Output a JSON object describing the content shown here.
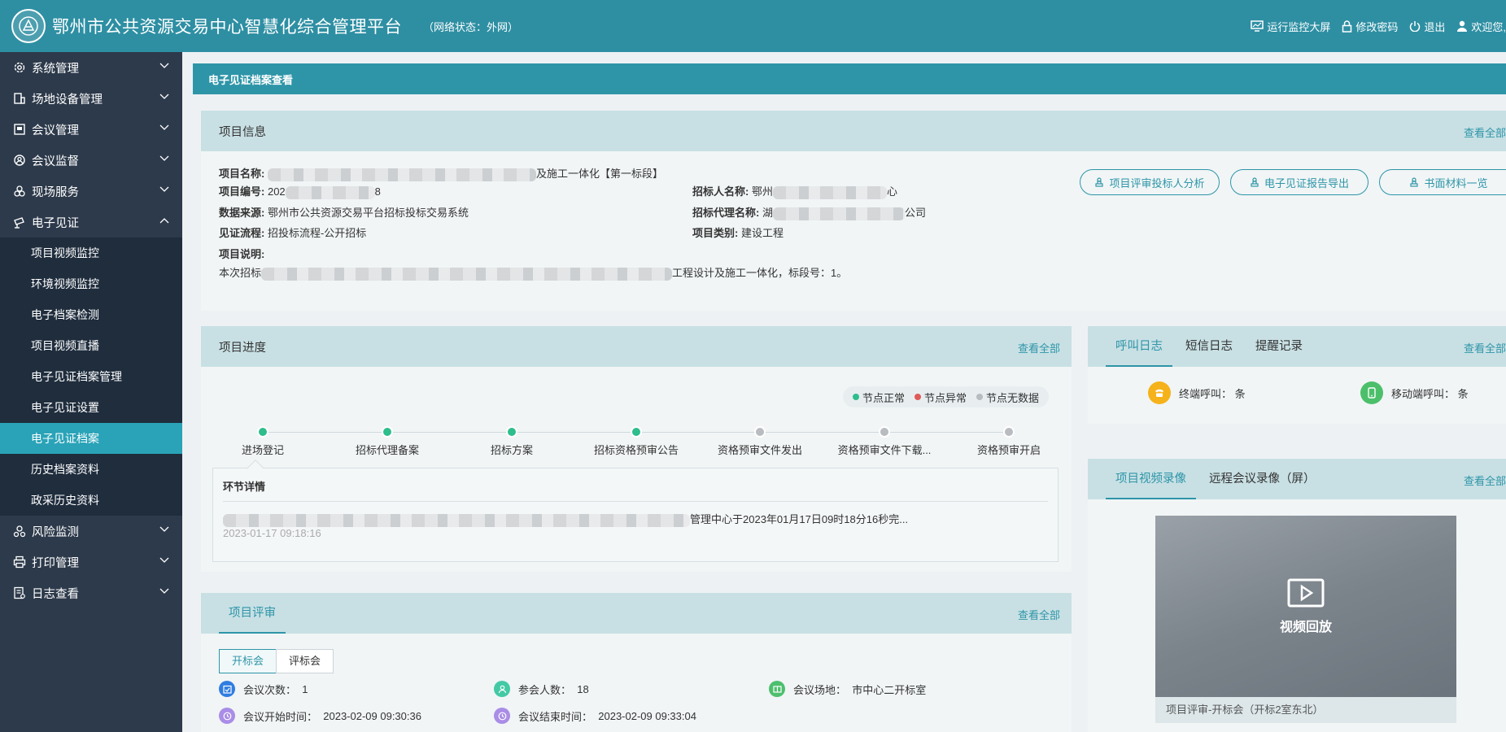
{
  "header": {
    "title": "鄂州市公共资源交易中心智慧化综合管理平台",
    "network_status": "（网络状态：外网）",
    "actions": [
      "运行监控大屏",
      "修改密码",
      "退出",
      "欢迎您,"
    ]
  },
  "sidebar": {
    "items": [
      {
        "label": "系统管理",
        "icon": "gear-icon"
      },
      {
        "label": "场地设备管理",
        "icon": "building-icon"
      },
      {
        "label": "会议管理",
        "icon": "meeting-icon"
      },
      {
        "label": "会议监督",
        "icon": "supervise-icon"
      },
      {
        "label": "现场服务",
        "icon": "service-icon"
      },
      {
        "label": "电子见证",
        "icon": "camera-icon"
      }
    ],
    "submenu": [
      "项目视频监控",
      "环境视频监控",
      "电子档案检测",
      "项目视频直播",
      "电子见证档案管理",
      "电子见证设置",
      "电子见证档案",
      "历史档案资料",
      "政采历史资料"
    ],
    "active_submenu": "电子见证档案",
    "bottom_items": [
      {
        "label": "风险监测",
        "icon": "risk-icon"
      },
      {
        "label": "打印管理",
        "icon": "printer-icon"
      },
      {
        "label": "日志查看",
        "icon": "log-icon"
      }
    ]
  },
  "page_title": "电子见证档案查看",
  "view_all": "查看全部",
  "project_info": {
    "title": "项目信息",
    "name_label": "项目名称:",
    "name_tail": "及施工一体化【第一标段】",
    "code_label": "项目编号:",
    "code_head": "202",
    "code_tail": "8",
    "source_label": "数据来源:",
    "source_value": "鄂州市公共资源交易平台招标投标交易系统",
    "flow_label": "见证流程:",
    "flow_value": "招投标流程-公开招标",
    "tenderer_label": "招标人名称:",
    "tenderer_head": "鄂州",
    "tenderer_tail": "心",
    "agent_label": "招标代理名称:",
    "agent_head": "湖",
    "agent_tail": "公司",
    "category_label": "项目类别:",
    "category_value": "建设工程",
    "desc_label": "项目说明:",
    "desc_head": "本次招标",
    "desc_tail": "工程设计及施工一体化，标段号：1。",
    "buttons": [
      "项目评审投标人分析",
      "电子见证报告导出",
      "书面材料一览"
    ]
  },
  "progress": {
    "title": "项目进度",
    "legend": [
      {
        "label": "节点正常",
        "color": "#2ebd8c"
      },
      {
        "label": "节点异常",
        "color": "#e05a5a"
      },
      {
        "label": "节点无数据",
        "color": "#b8bcc0"
      }
    ],
    "steps": [
      {
        "label": "进场登记",
        "status": "normal"
      },
      {
        "label": "招标代理备案",
        "status": "normal"
      },
      {
        "label": "招标方案",
        "status": "normal"
      },
      {
        "label": "招标资格预审公告",
        "status": "normal"
      },
      {
        "label": "资格预审文件发出",
        "status": "nodata"
      },
      {
        "label": "资格预审文件下载...",
        "status": "nodata"
      },
      {
        "label": "资格预审开启",
        "status": "nodata"
      }
    ],
    "detail_title": "环节详情",
    "detail_text": "管理中心于2023年01月17日09时18分16秒完...",
    "detail_time": "2023-01-17 09:18:16"
  },
  "logs": {
    "tabs": [
      "呼叫日志",
      "短信日志",
      "提醒记录"
    ],
    "terminal_call": "终端呼叫：  条",
    "mobile_call": "移动端呼叫：  条"
  },
  "video": {
    "tabs": [
      "项目视频录像",
      "远程会议录像（屏）"
    ],
    "play_label": "视频回放",
    "caption": "项目评审-开标会（开标2室东北）"
  },
  "review": {
    "title": "项目评审",
    "switch": [
      "开标会",
      "评标会"
    ],
    "count_label": "会议次数：",
    "count_value": "1",
    "people_label": "参会人数：",
    "people_value": "18",
    "venue_label": "会议场地：",
    "venue_value": "市中心二开标室",
    "start_label": "会议开始时间：",
    "start_value": "2023-02-09 09:30:36",
    "end_label": "会议结束时间：",
    "end_value": "2023-02-09 09:33:04"
  },
  "colors": {
    "primary": "#2e95a8",
    "header": "#2e8fa3",
    "sidebar": "#2d3a4b",
    "active_sub": "#2aa3b8"
  }
}
